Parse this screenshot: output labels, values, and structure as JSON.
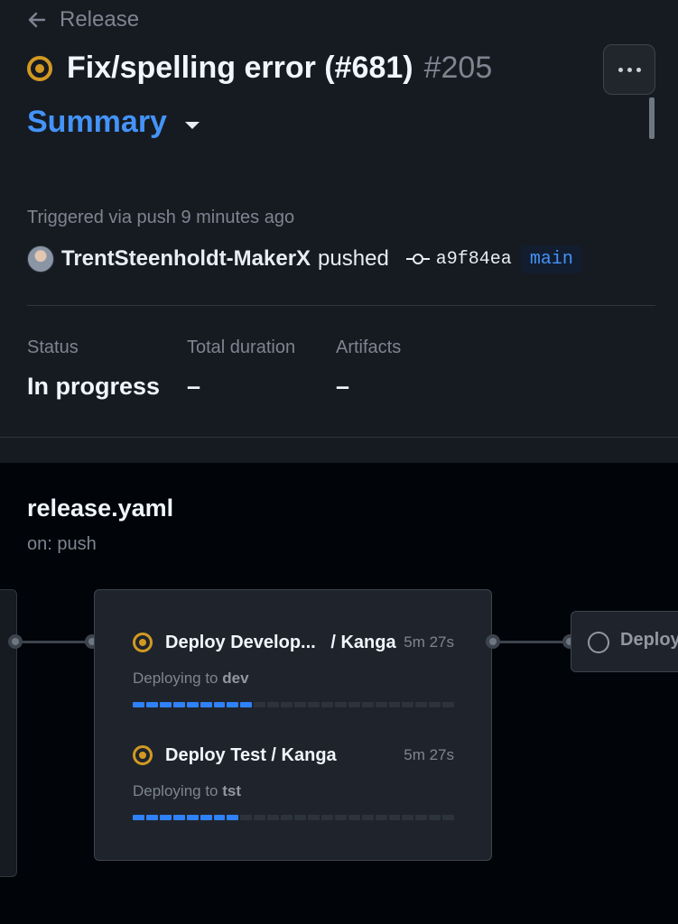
{
  "header": {
    "back_label": "Release",
    "title": "Fix/spelling error (#681)",
    "run_number": "#205",
    "section_label": "Summary"
  },
  "trigger": {
    "text": "Triggered via push 9 minutes ago",
    "user": "TrentSteenholdt-MakerX",
    "action": "pushed",
    "commit_sha": "a9f84ea",
    "branch": "main"
  },
  "stats": [
    {
      "label": "Status",
      "value": "In progress"
    },
    {
      "label": "Total duration",
      "value": "–"
    },
    {
      "label": "Artifacts",
      "value": "–"
    }
  ],
  "workflow": {
    "name": "release.yaml",
    "trigger": "on: push",
    "jobs": [
      {
        "name": "Deploy Develop...   / Kanga",
        "duration": "5m 27s",
        "desc_prefix": "Deploying to",
        "env": "dev",
        "progress": 0.37
      },
      {
        "name": "Deploy Test / Kanga",
        "duration": "5m 27s",
        "desc_prefix": "Deploying to",
        "env": "tst",
        "progress": 0.33
      }
    ],
    "next_job": "Deploy"
  },
  "colors": {
    "accent": "#4493f8",
    "in_progress": "#d29922",
    "progress_fill": "#2f81f7"
  }
}
